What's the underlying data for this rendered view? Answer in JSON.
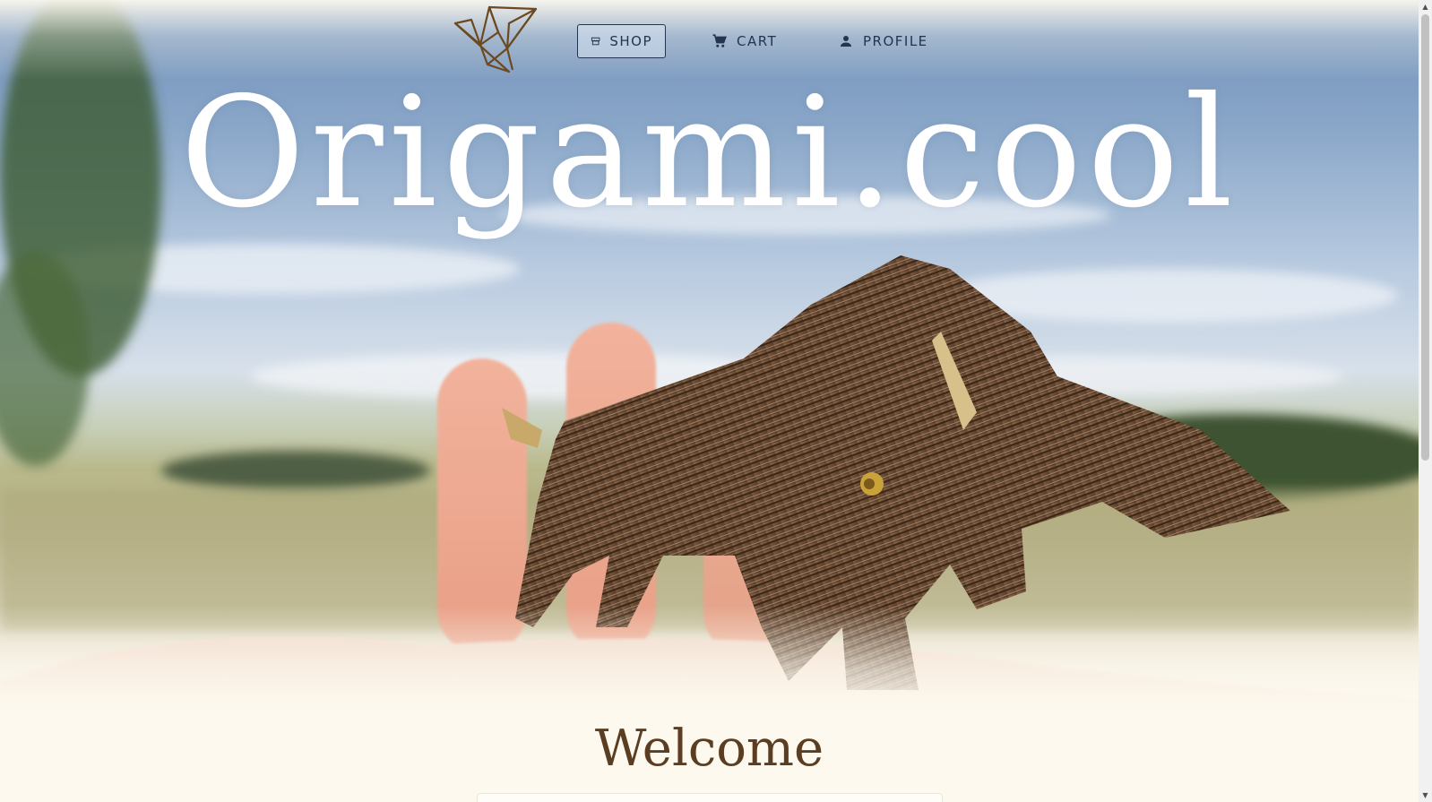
{
  "nav": {
    "shop_label": "SHOP",
    "cart_label": "CART",
    "profile_label": "PROFILE",
    "active": "shop",
    "icons": {
      "logo": "origami-bird-logo",
      "shop": "storefront-icon",
      "cart": "shopping-cart-icon",
      "profile": "person-icon"
    }
  },
  "hero": {
    "title": "Origami.cool",
    "image": "origami-bull-on-hand-photo"
  },
  "main": {
    "heading": "Welcome"
  },
  "colors": {
    "nav_text": "#24354f",
    "background": "#fdf9ef",
    "heading": "#5b3e22",
    "title": "#ffffff"
  }
}
